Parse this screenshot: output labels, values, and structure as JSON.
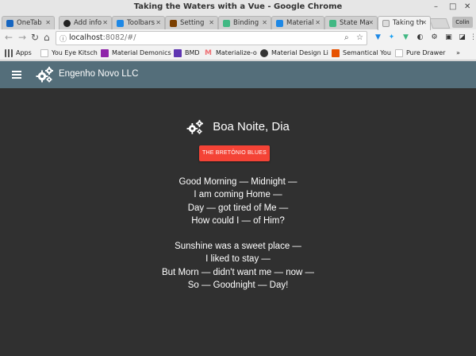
{
  "window": {
    "title": "Taking the Waters with a Vue - Google Chrome"
  },
  "tabs": [
    {
      "label": "OneTab",
      "color": "#1565c0",
      "active": false
    },
    {
      "label": "Add info",
      "color": "#222222",
      "active": false
    },
    {
      "label": "Toolbars",
      "color": "#1e88e5",
      "active": false
    },
    {
      "label": "Setting",
      "color": "#7b3f00",
      "active": false
    },
    {
      "label": "Binding",
      "color": "#41b883",
      "active": false
    },
    {
      "label": "Material",
      "color": "#1e88e5",
      "active": false
    },
    {
      "label": "State Ma",
      "color": "#41b883",
      "active": false
    },
    {
      "label": "Taking th",
      "color": "#999999",
      "active": true
    }
  ],
  "profile": {
    "label": "Colin"
  },
  "address": {
    "host": "localhost",
    "port_path": ":8082/#/"
  },
  "bookmarks": [
    {
      "label": "Apps",
      "color": "#555555"
    },
    {
      "label": "You Eye Kitsch",
      "color": "#ffffff"
    },
    {
      "label": "Material Demonics",
      "color": "#8e24aa"
    },
    {
      "label": "BMD",
      "color": "#5e35b1"
    },
    {
      "label": "Materialize-o",
      "color": "#ee6e73"
    },
    {
      "label": "Material Design Li",
      "color": "#333333"
    },
    {
      "label": "Semantical You",
      "color": "#e65100"
    },
    {
      "label": "Pure Drawer",
      "color": "#cccccc"
    }
  ],
  "bookmarks_more": "»",
  "app": {
    "title": "Engenho Novo LLC",
    "greeting": "Boa Noite, Dia",
    "button_label": "THE BRETÔNIO BLUES",
    "stanzas": [
      [
        "Good Morning — Midnight —",
        "I am coming Home —",
        "Day — got tired of Me —",
        "How could I — of Him?"
      ],
      [
        "Sunshine was a sweet place —",
        "I liked to stay —",
        "But Morn — didn't want me — now —",
        "So — Goodnight — Day!"
      ]
    ],
    "colors": {
      "appbar": "#546e7a",
      "background": "#303030",
      "button": "#f44336"
    }
  }
}
